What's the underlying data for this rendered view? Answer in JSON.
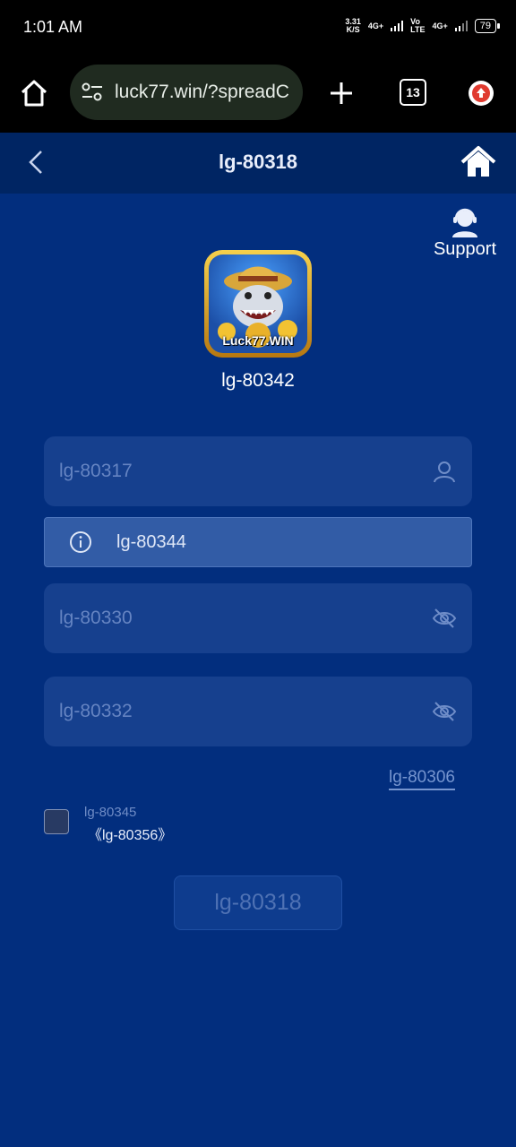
{
  "status_bar": {
    "time": "1:01 AM",
    "speed_value": "3.31",
    "speed_unit": "K/S",
    "net1": "4G+",
    "net2_a": "Vo",
    "net2_b": "LTE",
    "net3": "4G+",
    "battery": "79"
  },
  "browser": {
    "url": "luck77.win/?spreadC",
    "tab_count": "13"
  },
  "header": {
    "title": "lg-80318"
  },
  "support": {
    "label": "Support"
  },
  "logo": {
    "brand_text": "Luck77.WIN",
    "caption": "lg-80342"
  },
  "form": {
    "username_placeholder": "lg-80317",
    "notice_text": "lg-80344",
    "password_placeholder": "lg-80330",
    "confirm_placeholder": "lg-80332",
    "link_text": "lg-80306",
    "agree_text": "lg-80345",
    "agree_link": "《lg-80356》",
    "submit_label": "lg-80318"
  },
  "colors": {
    "background": "#022e7e",
    "header": "#002563",
    "field": "#16408e",
    "notice": "#325ca6"
  }
}
